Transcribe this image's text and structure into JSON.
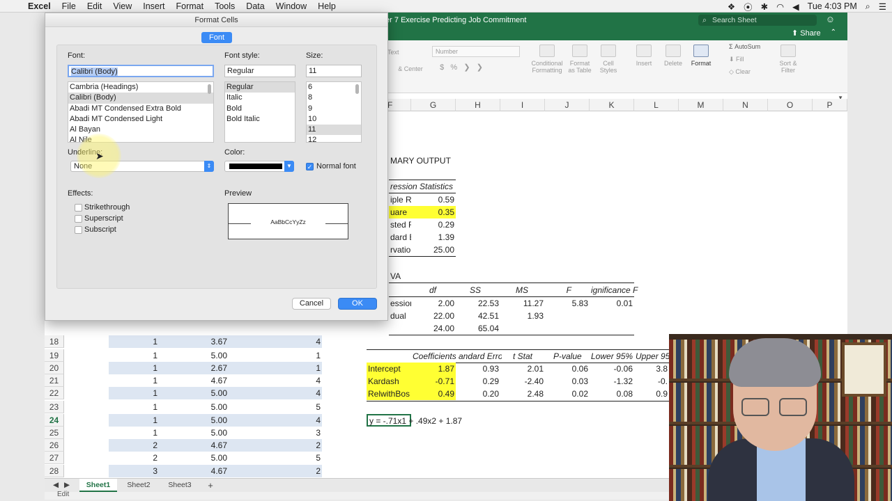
{
  "menubar": {
    "app": "Excel",
    "items": [
      "File",
      "Edit",
      "View",
      "Insert",
      "Format",
      "Tools",
      "Data",
      "Window",
      "Help"
    ],
    "clock": "Tue 4:03 PM"
  },
  "window": {
    "title": "ter 7 Exercise Predicting Job Commitment",
    "search_placeholder": "Search Sheet",
    "share": "Share"
  },
  "ribbon": {
    "font_size": "Text",
    "center": "& Center",
    "number_format": "Number",
    "cond_format": "Conditional Formatting",
    "format_table": "Format as Table",
    "cell_styles": "Cell Styles",
    "insert": "Insert",
    "delete": "Delete",
    "format": "Format",
    "autosum": "AutoSum",
    "fill": "Fill",
    "clear": "Clear",
    "sort_filter": "Sort & Filter"
  },
  "grid": {
    "columns": [
      "F",
      "G",
      "H",
      "I",
      "J",
      "K",
      "L",
      "M",
      "N",
      "O",
      "P"
    ],
    "rows": [
      {
        "n": "18",
        "b": "1",
        "c": "3.67",
        "d": "4"
      },
      {
        "n": "19",
        "b": "1",
        "c": "5.00",
        "d": "1"
      },
      {
        "n": "20",
        "b": "1",
        "c": "2.67",
        "d": "1"
      },
      {
        "n": "21",
        "b": "1",
        "c": "4.67",
        "d": "4"
      },
      {
        "n": "22",
        "b": "1",
        "c": "5.00",
        "d": "4"
      },
      {
        "n": "23",
        "b": "1",
        "c": "5.00",
        "d": "5"
      },
      {
        "n": "24",
        "b": "1",
        "c": "5.00",
        "d": "4"
      },
      {
        "n": "25",
        "b": "1",
        "c": "5.00",
        "d": "3"
      },
      {
        "n": "26",
        "b": "2",
        "c": "4.67",
        "d": "2"
      },
      {
        "n": "27",
        "b": "2",
        "c": "5.00",
        "d": "5"
      },
      {
        "n": "28",
        "b": "3",
        "c": "4.67",
        "d": "2"
      }
    ],
    "summary_output": "MARY OUTPUT",
    "reg_stats_header": "ression Statistics",
    "reg_stats": [
      {
        "label": "iple R",
        "value": "0.59"
      },
      {
        "label": "uare",
        "value": "0.35"
      },
      {
        "label": "sted R",
        "value": "0.29"
      },
      {
        "label": "dard E",
        "value": "1.39"
      },
      {
        "label": "rvatio",
        "value": "25.00"
      }
    ],
    "anova": "VA",
    "anova_headers": [
      "df",
      "SS",
      "MS",
      "F",
      "ignificance F"
    ],
    "anova_rows": [
      {
        "label": "ession",
        "df": "2.00",
        "ss": "22.53",
        "ms": "11.27",
        "f": "5.83",
        "sig": "0.01"
      },
      {
        "label": "dual",
        "df": "22.00",
        "ss": "42.51",
        "ms": "1.93",
        "f": "",
        "sig": ""
      },
      {
        "label": "",
        "df": "24.00",
        "ss": "65.04",
        "ms": "",
        "f": "",
        "sig": ""
      }
    ],
    "coef_headers": [
      "Coefficients",
      "andard Erro",
      "t Stat",
      "P-value",
      "Lower 95%",
      "Upper 95"
    ],
    "coef_rows": [
      {
        "label": "Intercept",
        "coef": "1.87",
        "se": "0.93",
        "t": "2.01",
        "p": "0.06",
        "low": "-0.06",
        "up": "3.8"
      },
      {
        "label": "Kardash",
        "coef": "-0.71",
        "se": "0.29",
        "t": "-2.40",
        "p": "0.03",
        "low": "-1.32",
        "up": "-0."
      },
      {
        "label": "RelwithBos",
        "coef": "0.49",
        "se": "0.20",
        "t": "2.48",
        "p": "0.02",
        "low": "0.08",
        "up": "0.9"
      }
    ],
    "equation": "y = -.71x1 + .49x2 + 1.87"
  },
  "sheets": [
    "Sheet1",
    "Sheet2",
    "Sheet3",
    "+"
  ],
  "status": "Edit",
  "dialog": {
    "title": "Format Cells",
    "tab": "Font",
    "font_label": "Font:",
    "font_value": "Calibri (Body)",
    "font_list": [
      "Cambria (Headings)",
      "Calibri (Body)",
      "Abadi MT Condensed Extra Bold",
      "Abadi MT Condensed Light",
      "Al Bayan",
      "Al Nile"
    ],
    "style_label": "Font style:",
    "style_value": "Regular",
    "style_list": [
      "Regular",
      "Italic",
      "Bold",
      "Bold Italic"
    ],
    "size_label": "Size:",
    "size_value": "11",
    "size_list": [
      "6",
      "8",
      "9",
      "10",
      "11",
      "12"
    ],
    "underline_label": "Underline:",
    "underline_value": "None",
    "color_label": "Color:",
    "normal_font": "Normal font",
    "effects_label": "Effects:",
    "effects": [
      "Strikethrough",
      "Superscript",
      "Subscript"
    ],
    "preview_label": "Preview",
    "preview_text": "AaBbCcYyZz",
    "cancel": "Cancel",
    "ok": "OK"
  }
}
